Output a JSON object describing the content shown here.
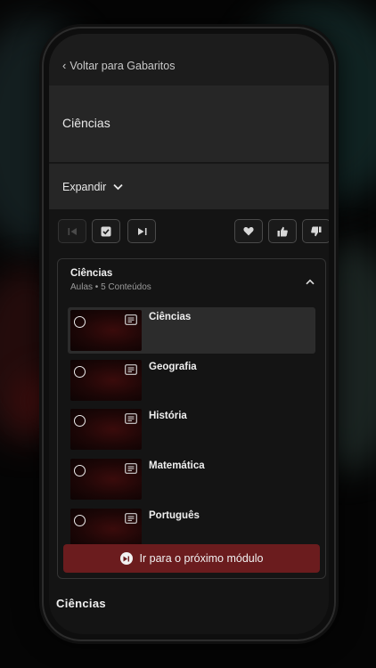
{
  "header": {
    "back_label": "Voltar para Gabaritos"
  },
  "page": {
    "title": "Ciências"
  },
  "expand": {
    "label": "Expandir"
  },
  "controls": {
    "left": [
      {
        "icon": "skip-previous-icon",
        "enabled": false
      },
      {
        "icon": "checkbox-icon",
        "enabled": true
      },
      {
        "icon": "skip-next-icon",
        "enabled": true
      }
    ],
    "right": [
      {
        "icon": "heart-icon"
      },
      {
        "icon": "thumbs-up-icon"
      },
      {
        "icon": "thumbs-down-icon"
      }
    ]
  },
  "module": {
    "title": "Ciências",
    "subtitle": "Aulas • 5 Conteúdos",
    "items": [
      {
        "label": "Ciências",
        "active": true
      },
      {
        "label": "Geografia",
        "active": false
      },
      {
        "label": "História",
        "active": false
      },
      {
        "label": "Matemática",
        "active": false
      },
      {
        "label": "Português",
        "active": false
      }
    ],
    "next_button": "Ir para o próximo módulo"
  },
  "footer": {
    "section_title": "Ciências"
  },
  "colors": {
    "accent": "#6b1c1e",
    "surface": "#262626",
    "background": "#141414"
  }
}
